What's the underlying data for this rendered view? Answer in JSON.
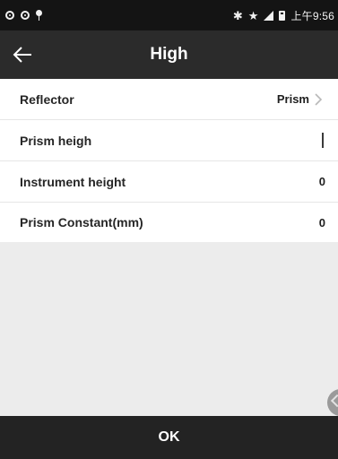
{
  "status_bar": {
    "time": "上午9:56",
    "icons": [
      "circle-notification-icon",
      "circle-notification-icon",
      "location-pin-icon",
      "bluetooth-icon",
      "star-icon",
      "signal-icon",
      "battery-icon"
    ]
  },
  "header": {
    "title": "High",
    "back_icon": "arrow-left-icon"
  },
  "rows": [
    {
      "label": "Reflector",
      "value": "Prism",
      "icon": "chevron-right-icon"
    },
    {
      "label": "Prism heigh",
      "value": ""
    },
    {
      "label": "Instrument height",
      "value": "0"
    },
    {
      "label": "Prism Constant(mm)",
      "value": "0"
    }
  ],
  "footer": {
    "ok_label": "OK"
  },
  "colors": {
    "status_bar_bg": "#141414",
    "title_bar_bg": "#2b2b2b",
    "content_bg": "#ececec",
    "list_bg": "#ffffff",
    "ok_bar_bg": "#232323"
  }
}
